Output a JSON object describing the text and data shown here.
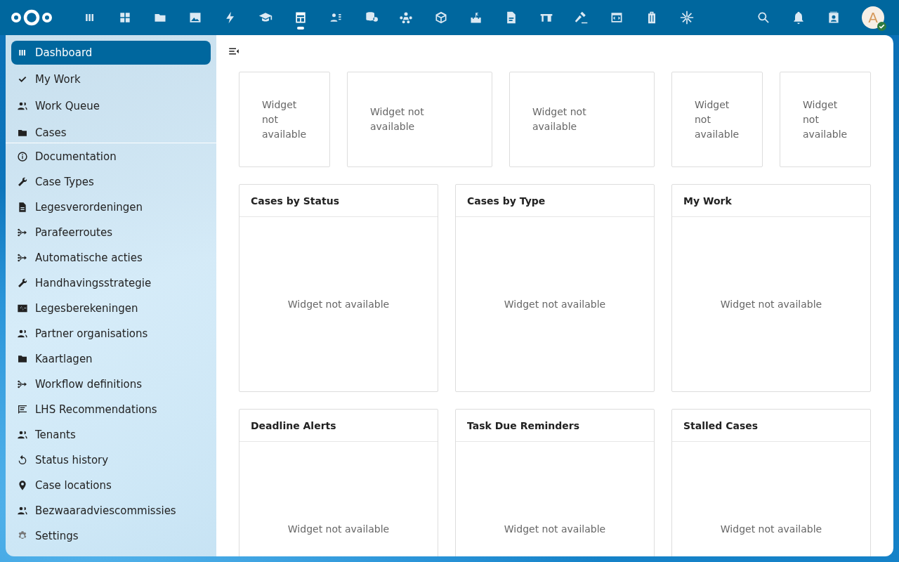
{
  "header": {
    "apps": [
      {
        "selected": false
      },
      {
        "selected": false
      },
      {
        "selected": false
      },
      {
        "selected": false
      },
      {
        "selected": false
      },
      {
        "selected": false
      },
      {
        "selected": true
      },
      {
        "selected": false
      },
      {
        "selected": false
      },
      {
        "selected": false
      },
      {
        "selected": false
      },
      {
        "selected": false
      },
      {
        "selected": false
      },
      {
        "selected": false
      },
      {
        "selected": false
      },
      {
        "selected": false
      },
      {
        "selected": false
      },
      {
        "selected": false
      }
    ],
    "avatar": {
      "initial": "A",
      "online": true
    }
  },
  "sidebar": {
    "items": [
      {
        "label": "Dashboard",
        "selected": true
      },
      {
        "label": "My Work",
        "selected": false
      },
      {
        "label": "Work Queue",
        "selected": false
      },
      {
        "label": "Cases",
        "selected": false
      }
    ],
    "footer_items": [
      {
        "label": "Documentation"
      },
      {
        "label": "Case Types"
      },
      {
        "label": "Legesverordeningen"
      },
      {
        "label": "Parafeerroutes"
      },
      {
        "label": "Automatische acties"
      },
      {
        "label": "Handhavingsstrategie"
      },
      {
        "label": "Legesberekeningen"
      },
      {
        "label": "Partner organisations"
      },
      {
        "label": "Kaartlagen"
      },
      {
        "label": "Workflow definitions"
      },
      {
        "label": "LHS Recommendations"
      },
      {
        "label": "Tenants"
      },
      {
        "label": "Status history"
      },
      {
        "label": "Case locations"
      },
      {
        "label": "Bezwaaradviescommissies"
      },
      {
        "label": "Settings"
      }
    ]
  },
  "small_widgets": [
    {
      "text": "Widget not available",
      "wide": false
    },
    {
      "text": "Widget not available",
      "wide": true
    },
    {
      "text": "Widget not available",
      "wide": true
    },
    {
      "text": "Widget not available",
      "wide": false
    },
    {
      "text": "Widget not available",
      "wide": false
    }
  ],
  "widgets": [
    {
      "title": "Cases by Status",
      "text": "Widget not available"
    },
    {
      "title": "Cases by Type",
      "text": "Widget not available"
    },
    {
      "title": "My Work",
      "text": "Widget not available"
    },
    {
      "title": "Deadline Alerts",
      "text": "Widget not available"
    },
    {
      "title": "Task Due Reminders",
      "text": "Widget not available"
    },
    {
      "title": "Stalled Cases",
      "text": "Widget not available"
    }
  ]
}
